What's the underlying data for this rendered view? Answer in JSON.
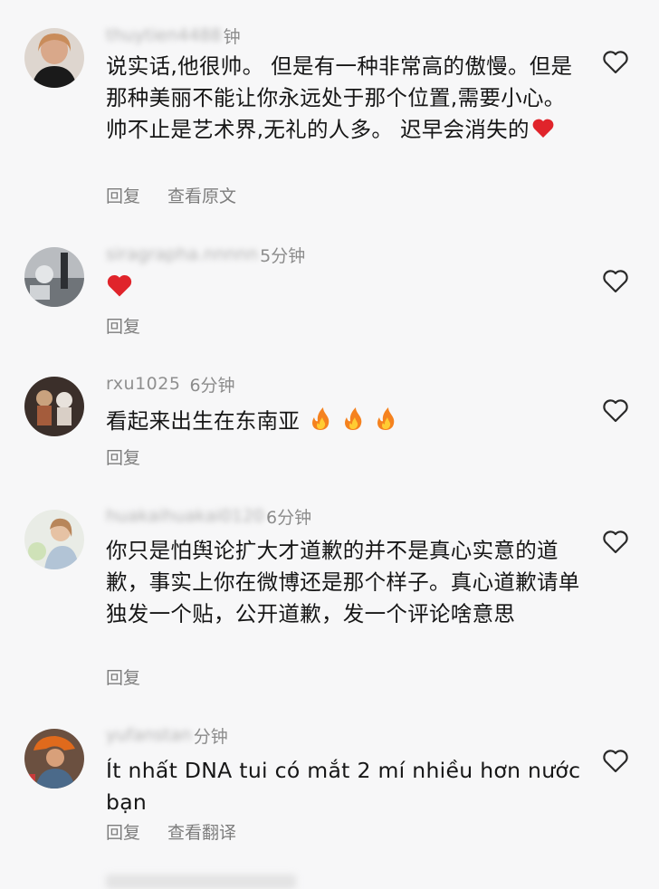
{
  "comments": [
    {
      "username": "thuytien4488",
      "time": "钟",
      "text": "说实话,他很帅。 但是有一种非常高的傲慢。但是那种美丽不能让你永远处于那个位置,需要小心。 帅不止是艺术界,无礼的人多。 迟早会消失的",
      "emoji": "red-heart",
      "actions": [
        "回复",
        "查看原文"
      ]
    },
    {
      "username": "siragrapha.nnnnn",
      "time": "5分钟",
      "text": "",
      "emoji": "red-heart",
      "actions": [
        "回复"
      ]
    },
    {
      "username": "rxu1025",
      "time": "6分钟",
      "text": "看起来出生在东南亚",
      "emoji": "fire-x3",
      "actions": [
        "回复"
      ]
    },
    {
      "username": "huakaihuakai0120",
      "time": "6分钟",
      "text": "你只是怕舆论扩大才道歉的并不是真心实意的道歉，事实上你在微博还是那个样子。真心道歉请单独发一个贴，公开道歉，发一个评论啥意思",
      "emoji": "",
      "actions": [
        "回复"
      ]
    },
    {
      "username": "yufanstan",
      "time": "分钟",
      "text": "Ít nhất DNA tui có mắt 2 mí nhiều hơn nước bạn",
      "emoji": "",
      "actions": [
        "回复",
        "查看翻译"
      ]
    }
  ],
  "colors": {
    "background": "#f7f7f8",
    "text": "#161616",
    "meta": "#8c8c8c",
    "heart_emoji": "#e0242b",
    "fire_outer": "#f5821f",
    "fire_inner": "#ffcc33"
  },
  "icons": {
    "like": "heart-outline-icon",
    "heart_emoji": "red-heart-emoji",
    "fire_emoji": "fire-emoji"
  }
}
